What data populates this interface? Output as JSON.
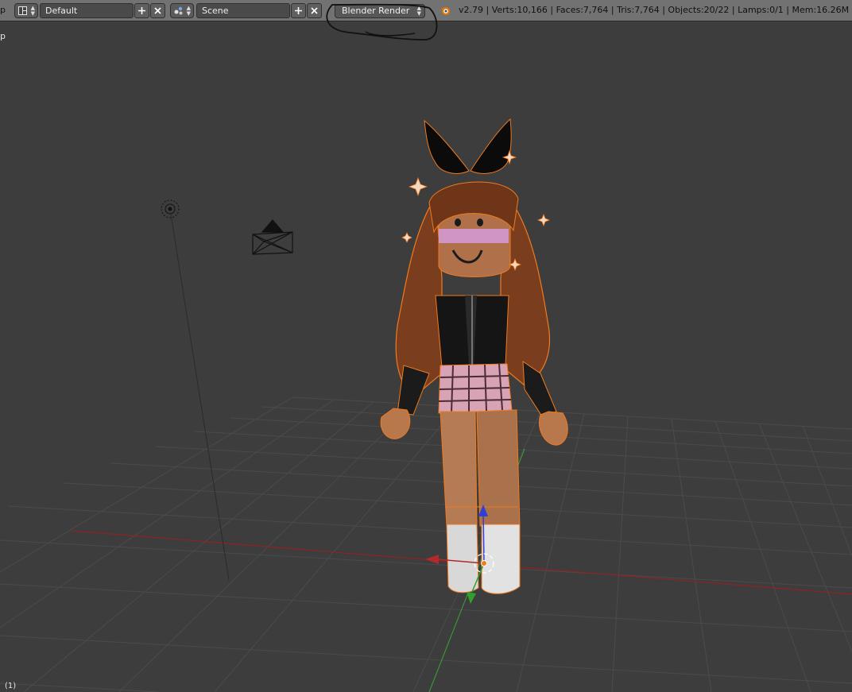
{
  "header": {
    "trunc_label": "p",
    "layout": {
      "value": "Default",
      "icon": "screen-layout-icon"
    },
    "scene": {
      "value": "Scene",
      "icon": "scene-icon"
    },
    "add_icon": "plus-icon",
    "remove_icon": "x-icon",
    "render_engine": "Blender Render",
    "logo_icon": "blender-logo-icon",
    "stats": "v2.79 | Verts:10,166 | Faces:7,764 | Tris:7,764 | Objects:20/22 | Lamps:0/1 | Mem:16.26M"
  },
  "viewport": {
    "corner_label": "p",
    "frame_label": "(1)"
  },
  "colors": {
    "header_bg": "#727272",
    "viewport_bg": "#3d3d3d",
    "selection_outline": "#f07a1e",
    "x_axis": "#b12a2a",
    "y_axis": "#2fa02f",
    "z_axis": "#2f3fd8"
  }
}
